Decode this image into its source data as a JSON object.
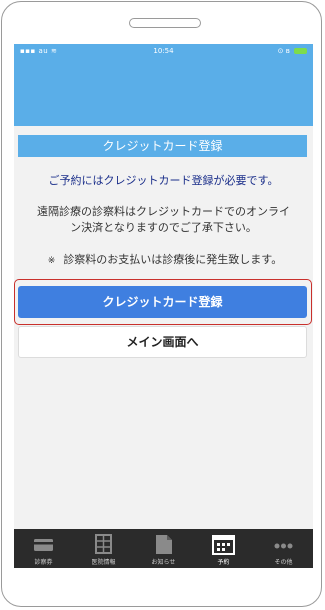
{
  "status_bar": {
    "carrier": "au",
    "time": "10:54"
  },
  "screen": {
    "title": "クレジットカード登録",
    "required_message": "ご予約にはクレジットカード登録が必要です。",
    "info_line1": "遠隔診療の診察料はクレジットカードでのオンライ",
    "info_line2": "ン決済となりますのでご了承下さい。",
    "note_mark": "※",
    "note": "診察料のお支払いは診療後に発生致します。"
  },
  "buttons": {
    "register": "クレジットカード登録",
    "main_screen": "メイン画面へ"
  },
  "tabs": [
    {
      "label": "診察券",
      "icon": "card-icon"
    },
    {
      "label": "医院情報",
      "icon": "building-icon"
    },
    {
      "label": "お知らせ",
      "icon": "document-icon"
    },
    {
      "label": "予約",
      "icon": "calendar-icon",
      "active": true
    },
    {
      "label": "その他",
      "icon": "more-icon"
    }
  ],
  "colors": {
    "header": "#5aaee8",
    "primary_button": "#3f7fe0",
    "highlight_outline": "#c9302c",
    "tabbar": "#2b2b2b",
    "message_text": "#1a2e8a"
  }
}
